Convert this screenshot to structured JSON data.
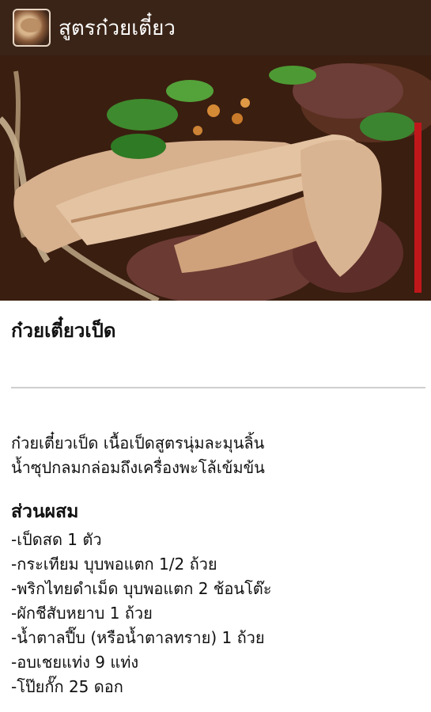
{
  "app": {
    "title": "สูตรก๋วยเตี๋ยว",
    "icon": "app-logo-noodle-icon"
  },
  "recipe": {
    "title": "ก๋วยเตี๋ยวเป็ด",
    "description_lines": [
      "ก๋วยเตี๋ยวเป็ด เนื้อเป็ดสูตรนุ่มละมุนลิ้น",
      "น้ำซุปกลมกล่อมถึงเครื่องพะโล้เข้มข้น"
    ],
    "ingredients_header": "ส่วนผสม",
    "ingredients": [
      "-เป็ดสด 1 ตัว",
      "-กระเทียม บุบพอแตก 1/2 ถ้วย",
      "-พริกไทยดำเม็ด บุบพอแตก 2 ช้อนโต๊ะ",
      "-ผักชีสับหยาบ 1 ถ้วย",
      "-น้ำตาลปี๊บ (หรือน้ำตาลทราย) 1 ถ้วย",
      "-อบเชยแท่ง 9 แท่ง",
      "-โป๊ยกั๊ก 25 ดอก"
    ]
  },
  "colors": {
    "appbar": "#3a2417",
    "scroll_indicator": "#c0171b",
    "divider": "#cfcfcf"
  }
}
